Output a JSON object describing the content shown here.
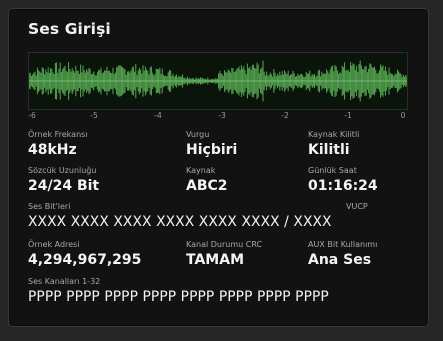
{
  "panel": {
    "title": "Ses Girişi"
  },
  "meter": {
    "scale": [
      "-6",
      "-5",
      "-4",
      "-3",
      "-2",
      "-1",
      "0"
    ],
    "waveform_color": "#5fb85a"
  },
  "fields": {
    "sample_rate": {
      "label": "Örnek Frekansı",
      "value": "48kHz"
    },
    "emphasis": {
      "label": "Vurgu",
      "value": "Hiçbiri"
    },
    "source_lock": {
      "label": "Kaynak Kilitli",
      "value": "Kilitli"
    },
    "word_length": {
      "label": "Sözcük Uzunluğu",
      "value": "24/24 Bit"
    },
    "source": {
      "label": "Kaynak",
      "value": "ABC2"
    },
    "time_of_day": {
      "label": "Günlük Saat",
      "value": "01:16:24"
    },
    "audio_bits": {
      "label": "Ses Bit'leri",
      "vucp_label": "VUCP",
      "value": "XXXX XXXX XXXX XXXX XXXX XXXX / XXXX"
    },
    "sample_address": {
      "label": "Örnek Adresi",
      "value": "4,294,967,295"
    },
    "channel_status_crc": {
      "label": "Kanal Durumu CRC",
      "value": "TAMAM"
    },
    "aux_bit_usage": {
      "label": "AUX Bit Kullanımı",
      "value": "Ana Ses"
    },
    "channels": {
      "label": "Ses Kanalları 1-32",
      "value": "PPPP PPPP PPPP PPPP PPPP PPPP PPPP PPPP"
    }
  }
}
